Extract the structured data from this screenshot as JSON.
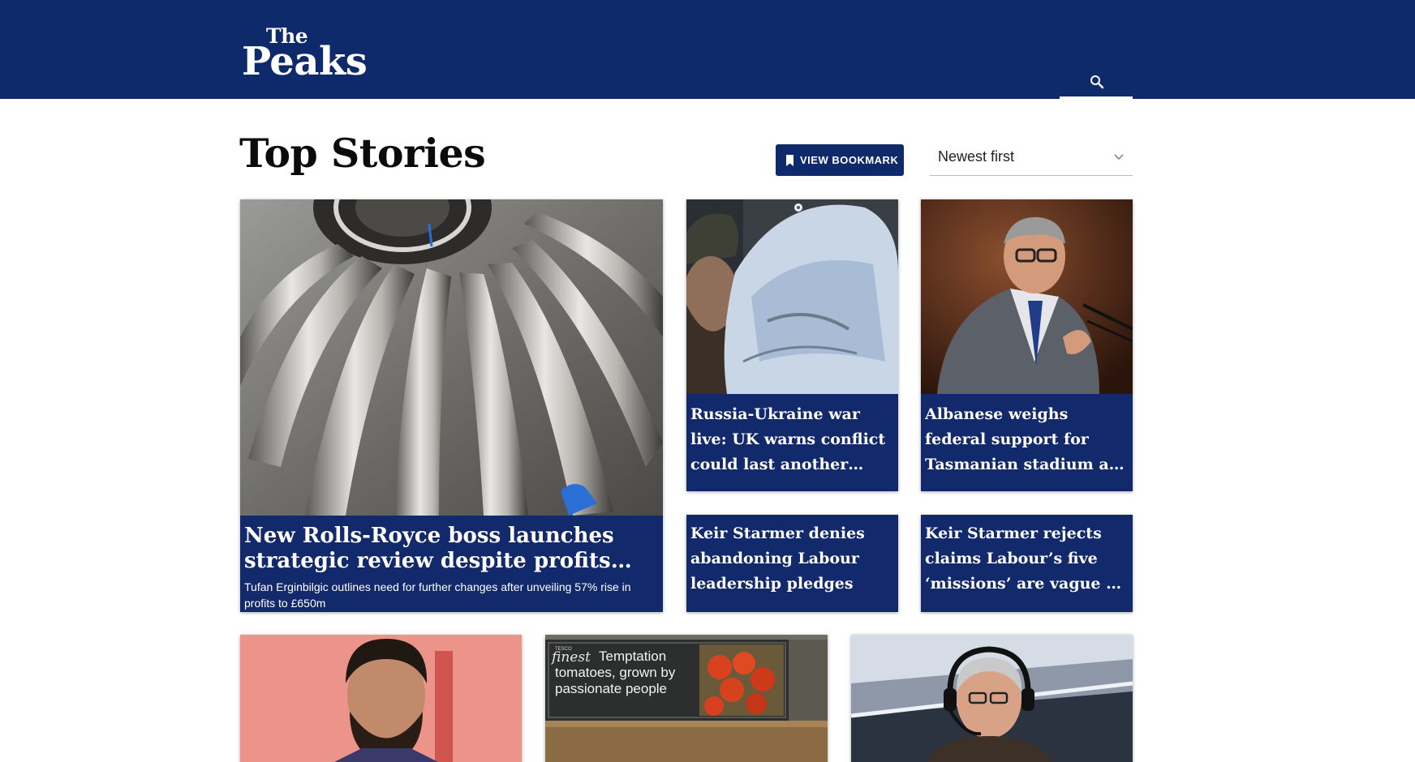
{
  "header": {
    "logo_top": "The",
    "logo_bottom": "Peaks",
    "search_icon": "search-icon",
    "bg_color": "#0f2a6b"
  },
  "page": {
    "title": "Top Stories",
    "bookmark_label": "VIEW BOOKMARK",
    "bookmark_icon": "bookmark-icon",
    "sort_selected": "Newest first",
    "sort_icon": "chevron-down-icon"
  },
  "stories": {
    "hero": {
      "headline": "New Rolls-Royce boss launches strategic review despite profits rise",
      "summary": "Tufan Erginbilgic outlines need for further changes after unveiling 57% rise in profits to £650m"
    },
    "card1": {
      "headline": "Russia-Ukraine war live: UK warns conflict could last another year; Russia accuses West"
    },
    "card2": {
      "headline": "Albanese weighs federal support for Tasmanian stadium as AFL pledges funding"
    },
    "card3": {
      "headline": "Keir Starmer denies abandoning Labour leadership pledges"
    },
    "card4": {
      "headline": "Keir Starmer rejects claims Labour’s five ‘missions’ are vague or meaningless"
    },
    "bottom2": {
      "sign_brand": "TESCO",
      "sign_script": "finest",
      "sign_line1": "Temptation",
      "sign_line2": "tomatoes, grown by",
      "sign_line3": "passionate people"
    }
  }
}
